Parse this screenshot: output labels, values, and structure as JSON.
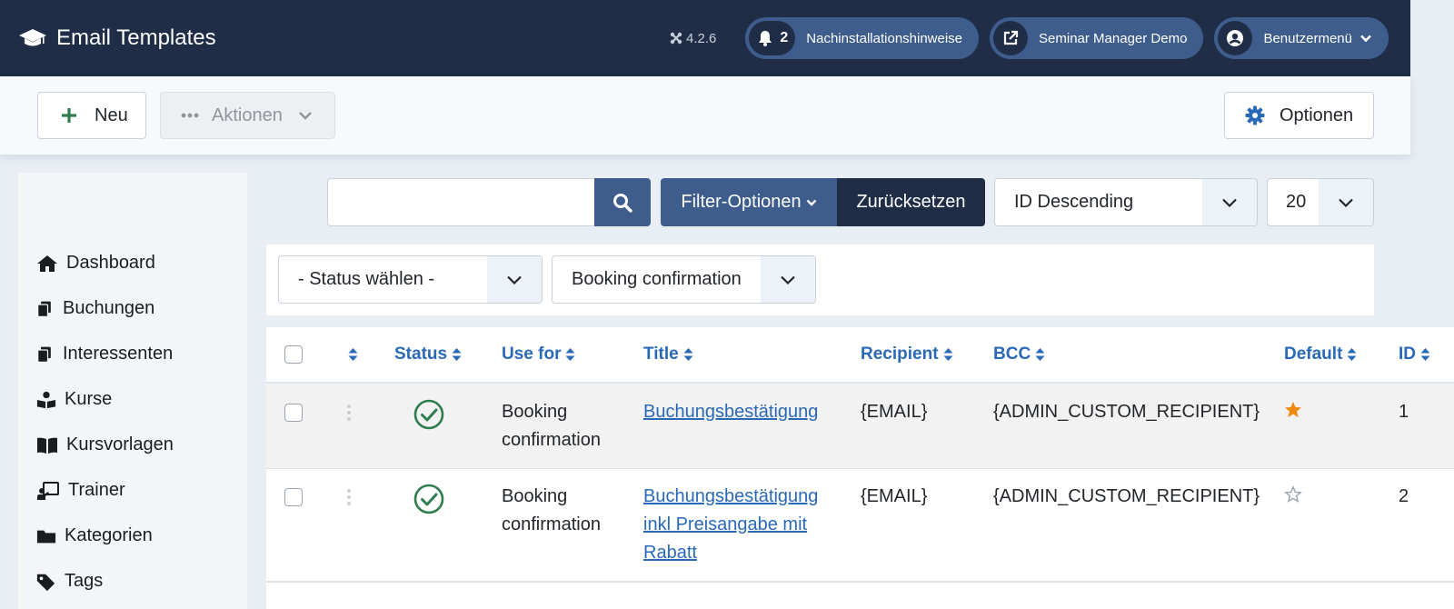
{
  "header": {
    "title": "Email Templates",
    "version": "4.2.6",
    "notifications": {
      "count": "2",
      "label": "Nachinstallationshinweise"
    },
    "site_link": "Seminar Manager Demo",
    "user_menu": "Benutzermenü"
  },
  "toolbar": {
    "new_label": "Neu",
    "actions_label": "Aktionen",
    "options_label": "Optionen"
  },
  "sidebar": {
    "items": [
      {
        "label": "Dashboard",
        "icon": "home-icon"
      },
      {
        "label": "Buchungen",
        "icon": "copy-icon"
      },
      {
        "label": "Interessenten",
        "icon": "copy-icon"
      },
      {
        "label": "Kurse",
        "icon": "book-reader-icon"
      },
      {
        "label": "Kursvorlagen",
        "icon": "book-open-icon"
      },
      {
        "label": "Trainer",
        "icon": "chalkboard-teacher-icon"
      },
      {
        "label": "Kategorien",
        "icon": "folder-icon"
      },
      {
        "label": "Tags",
        "icon": "tag-icon"
      }
    ]
  },
  "search": {
    "value": "",
    "filter_options_label": "Filter-Optionen",
    "reset_label": "Zurücksetzen",
    "ordering": "ID Descending",
    "limit": "20"
  },
  "filters": {
    "status": "- Status wählen -",
    "use_for": "Booking confirmation"
  },
  "table": {
    "columns": {
      "status": "Status",
      "use_for": "Use for",
      "title": "Title",
      "recipient": "Recipient",
      "bcc": "BCC",
      "default": "Default",
      "id": "ID"
    },
    "rows": [
      {
        "use_for_line1": "Booking",
        "use_for_line2": "confirmation",
        "title_line1": "Buchungsbestätigung",
        "title_line2": "",
        "title_line3": "",
        "recipient": "{EMAIL}",
        "bcc": "{ADMIN_CUSTOM_RECIPIENT}",
        "default": true,
        "id": "1"
      },
      {
        "use_for_line1": "Booking",
        "use_for_line2": "confirmation",
        "title_line1": "Buchungsbestätigung",
        "title_line2": "inkl Preisangabe mit",
        "title_line3": "Rabatt",
        "recipient": "{EMAIL}",
        "bcc": "{ADMIN_CUSTOM_RECIPIENT}",
        "default": false,
        "id": "2"
      }
    ]
  },
  "colors": {
    "header_bg": "#1f2d47",
    "pill_bg": "#3e5d8d",
    "link": "#2a69b8",
    "status_ok": "#2f7d4f",
    "star_active": "#f0880e"
  }
}
